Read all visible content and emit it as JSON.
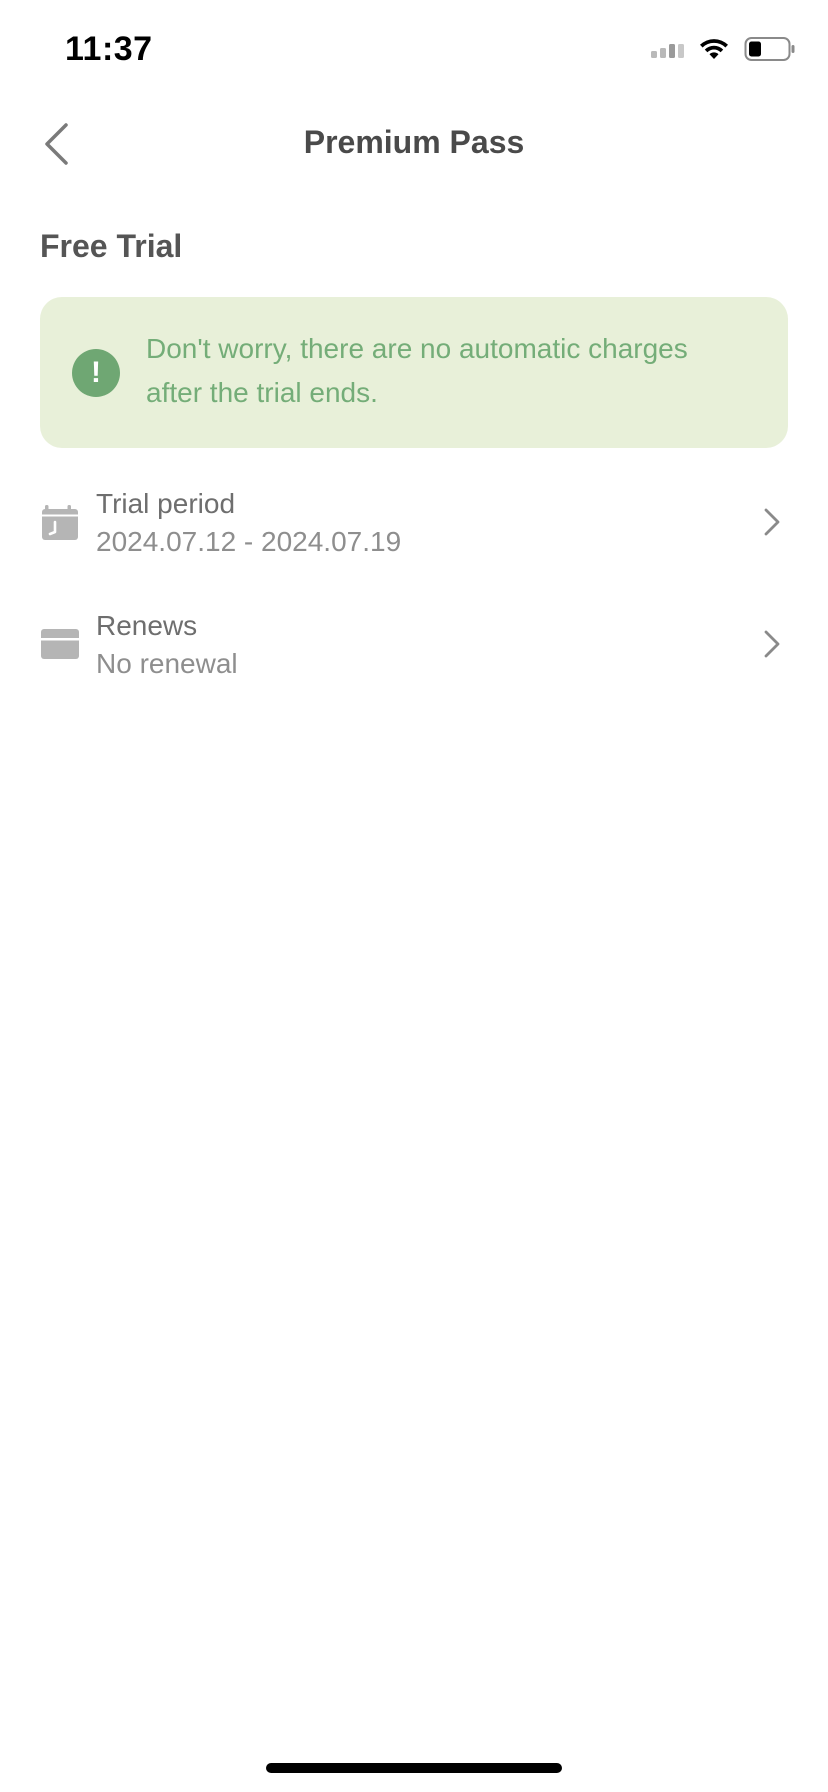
{
  "status_bar": {
    "time": "11:37"
  },
  "nav": {
    "title": "Premium Pass",
    "back_icon": "chevron-left-icon"
  },
  "section": {
    "heading": "Free Trial"
  },
  "banner": {
    "icon": "exclamation-circle-icon",
    "icon_glyph": "!",
    "text": "Don't worry, there are no automatic charges after the trial ends.",
    "background_color": "#e8f0d9",
    "text_color": "#74ad78",
    "icon_color": "#6fa773"
  },
  "rows": [
    {
      "icon": "calendar-icon",
      "title": "Trial period",
      "value": "2024.07.12 - 2024.07.19"
    },
    {
      "icon": "credit-card-icon",
      "title": "Renews",
      "value": "No renewal"
    }
  ],
  "colors": {
    "title_text": "#4a4a4a",
    "secondary_text": "#8e8e8e",
    "icon_gray": "#b5b5b5"
  }
}
